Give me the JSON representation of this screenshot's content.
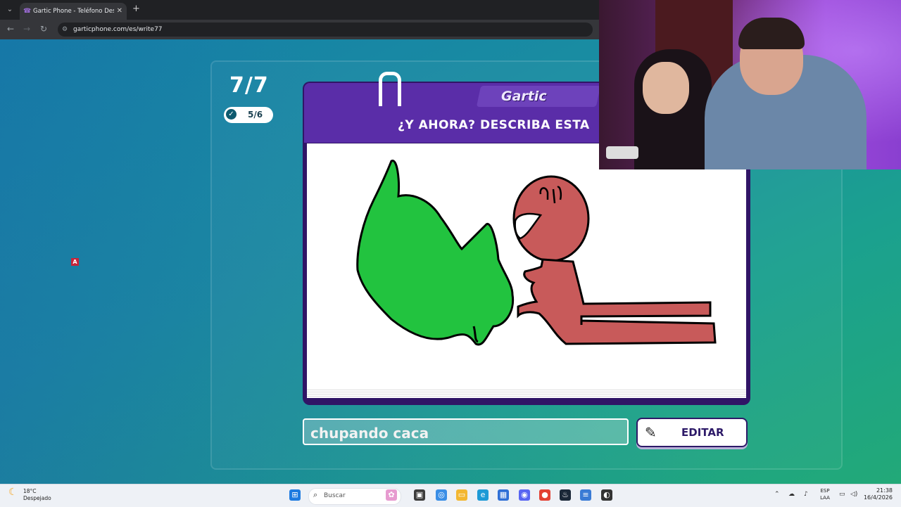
{
  "browser": {
    "tab_title": "Gartic Phone - Teléfono Descon",
    "url": "garticphone.com/es/write77"
  },
  "game": {
    "round": "7/7",
    "done_count": "5/6",
    "logo": "Gartic",
    "prompt": "¿Y AHORA? DESCRIBA ESTA",
    "answer": "chupando caca",
    "edit_label": "EDITAR",
    "marker_letter": "A"
  },
  "taskbar": {
    "temperature": "18°C",
    "weather": "Despejado",
    "search_placeholder": "Buscar",
    "lang_top": "ESP",
    "lang_bottom": "LAA",
    "time": "21:38",
    "date": "16/4/2026"
  },
  "colors": {
    "accent": "#5a2da8",
    "drawing_green": "#22c33f",
    "drawing_red": "#c85a5a"
  }
}
